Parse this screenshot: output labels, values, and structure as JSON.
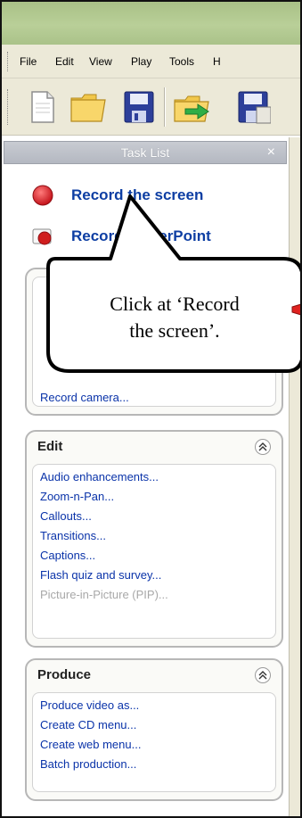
{
  "menu": {
    "items": [
      "File",
      "Edit",
      "View",
      "Play",
      "Tools",
      "H"
    ]
  },
  "toolbar": {
    "buttons": [
      "new-file-icon",
      "open-folder-icon",
      "save-icon",
      "import-folder-icon",
      "export-icon"
    ]
  },
  "task_list": {
    "title": "Task List",
    "close_glyph": "×",
    "record_screen": "Record the screen",
    "record_powerpoint": "Record PowerPoint"
  },
  "capture_group": {
    "visible_link": "Record camera..."
  },
  "edit_group": {
    "title": "Edit",
    "links": [
      "Audio enhancements...",
      "Zoom-n-Pan...",
      "Callouts...",
      "Transitions...",
      "Captions...",
      "Flash quiz and survey..."
    ],
    "disabled_link": "Picture-in-Picture (PIP)..."
  },
  "produce_group": {
    "title": "Produce",
    "links": [
      "Produce video as...",
      "Create CD menu...",
      "Create web menu...",
      "Batch production..."
    ]
  },
  "callout": {
    "line1": "Click at ‘Record",
    "line2": "the screen’."
  },
  "colors": {
    "titlebar": "#aac289",
    "link_blue": "#0a33a9",
    "record_red": "#d81c1c"
  }
}
